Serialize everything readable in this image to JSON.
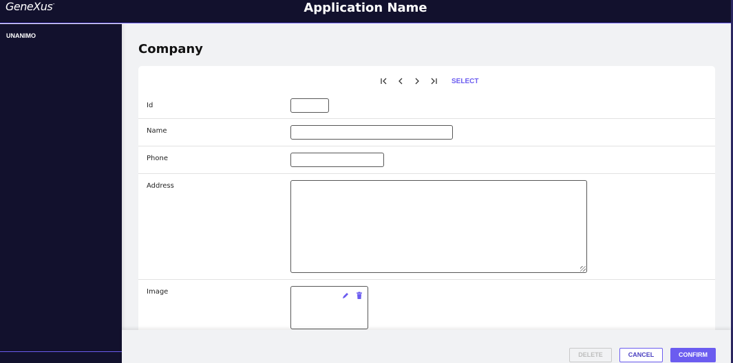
{
  "header": {
    "logo": "GeneXus",
    "logo_tm": "™",
    "app_title": "Application Name"
  },
  "sidebar": {
    "items": [
      {
        "label": "UNANIMO"
      }
    ]
  },
  "page": {
    "title": "Company"
  },
  "pager": {
    "first_icon": "first-page-icon",
    "prev_icon": "previous-icon",
    "next_icon": "next-icon",
    "last_icon": "last-page-icon",
    "select_label": "SELECT"
  },
  "form": {
    "fields": [
      {
        "label": "Id",
        "value": ""
      },
      {
        "label": "Name",
        "value": ""
      },
      {
        "label": "Phone",
        "value": ""
      },
      {
        "label": "Address",
        "value": ""
      },
      {
        "label": "Image",
        "value": ""
      }
    ],
    "image_actions": [
      "edit-icon",
      "trash-icon"
    ]
  },
  "actions": {
    "delete_label": "DELETE",
    "cancel_label": "CANCEL",
    "confirm_label": "CONFIRM"
  },
  "colors": {
    "accent": "#6b5cf0",
    "header_bg": "#12112d",
    "page_bg": "#f1f2f4"
  }
}
